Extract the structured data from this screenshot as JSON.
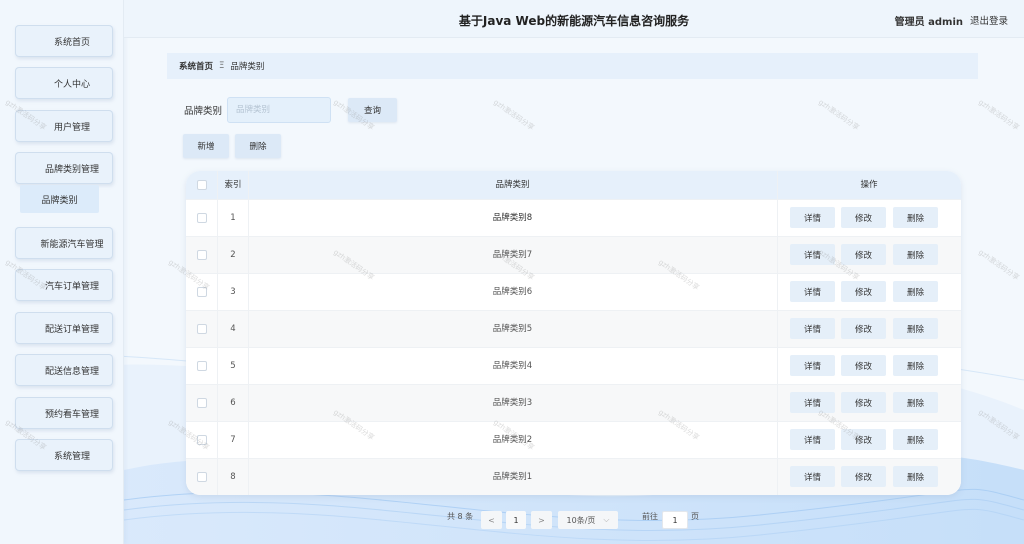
{
  "header": {
    "title": "基于Java Web的新能源汽车信息咨询服务",
    "user": "管理员 admin",
    "logout": "退出登录"
  },
  "sidebar": {
    "items": [
      {
        "label": "系统首页"
      },
      {
        "label": "个人中心"
      },
      {
        "label": "用户管理"
      },
      {
        "label": "品牌类别管理"
      },
      {
        "label": "新能源汽车管理"
      },
      {
        "label": "汽车订单管理"
      },
      {
        "label": "配送订单管理"
      },
      {
        "label": "配送信息管理"
      },
      {
        "label": "预约看车管理"
      },
      {
        "label": "系统管理"
      }
    ],
    "sub_item": "品牌类别"
  },
  "breadcrumb": {
    "home": "系统首页",
    "separator": "Ξ",
    "current": "品牌类别"
  },
  "search": {
    "label": "品牌类别",
    "placeholder": "品牌类别",
    "query_button": "查询"
  },
  "actions": {
    "add": "新增",
    "delete": "删除"
  },
  "table": {
    "headers": {
      "index": "索引",
      "name": "品牌类别",
      "ops": "操作"
    },
    "rows": [
      {
        "index": "1",
        "name": "品牌类别8"
      },
      {
        "index": "2",
        "name": "品牌类别7"
      },
      {
        "index": "3",
        "name": "品牌类别6"
      },
      {
        "index": "4",
        "name": "品牌类别5"
      },
      {
        "index": "5",
        "name": "品牌类别4"
      },
      {
        "index": "6",
        "name": "品牌类别3"
      },
      {
        "index": "7",
        "name": "品牌类别2"
      },
      {
        "index": "8",
        "name": "品牌类别1"
      }
    ],
    "row_buttons": {
      "detail": "详情",
      "edit": "修改",
      "delete": "删除"
    }
  },
  "pagination": {
    "total": "共 8 条",
    "prev": "<",
    "current_page": "1",
    "next": ">",
    "page_size": "10条/页",
    "goto_label": "前往",
    "goto_value": "1",
    "page_suffix": "页"
  },
  "watermark": "gzh激活码分享"
}
